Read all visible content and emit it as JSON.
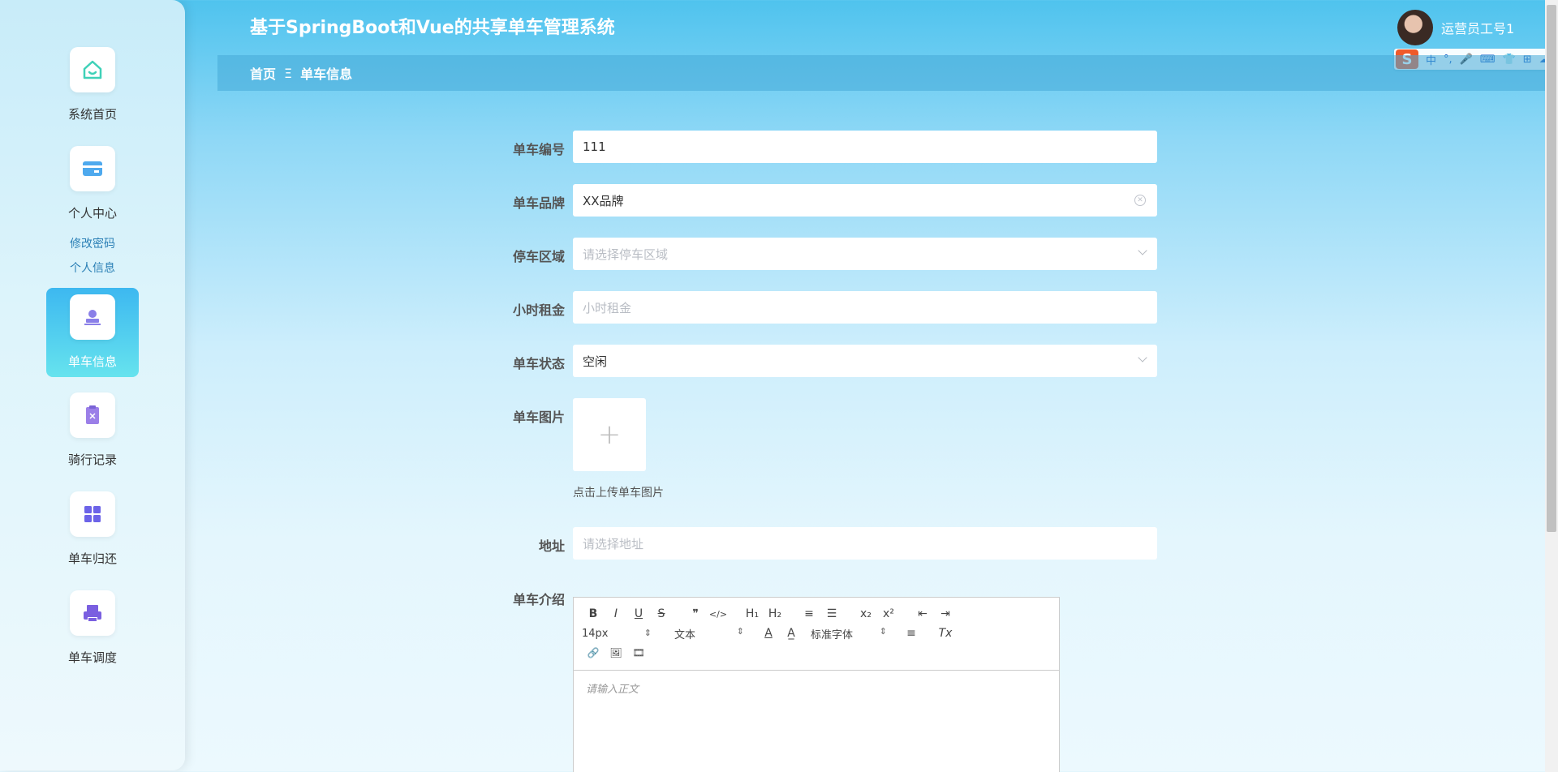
{
  "app": {
    "title": "基于SpringBoot和Vue的共享单车管理系统"
  },
  "breadcrumb": {
    "home": "首页",
    "separator": "Ξ",
    "current": "单车信息"
  },
  "user": {
    "name": "运营员工号1"
  },
  "ime": {
    "icons": [
      "中",
      "°,",
      "🎤",
      "⌨",
      "👕",
      "⊞",
      "☁"
    ]
  },
  "sidebar": {
    "items": [
      {
        "label": "系统首页",
        "icon": "home-icon",
        "color": "#3fd1b8"
      },
      {
        "label": "个人中心",
        "icon": "card-icon",
        "color": "#4ea9ee"
      },
      {
        "label": "单车信息",
        "icon": "stamp-icon",
        "color": "#8a7fe8",
        "active": true
      },
      {
        "label": "骑行记录",
        "icon": "clipboard-icon",
        "color": "#9b7fe8"
      },
      {
        "label": "单车归还",
        "icon": "grid-icon",
        "color": "#6c63e8"
      },
      {
        "label": "单车调度",
        "icon": "printer-icon",
        "color": "#7a5fe0"
      }
    ],
    "sub_items": [
      "修改密码",
      "个人信息"
    ]
  },
  "form": {
    "bike_number": {
      "label": "单车编号",
      "value": "111"
    },
    "bike_brand": {
      "label": "单车品牌",
      "value": "XX品牌"
    },
    "parking_area": {
      "label": "停车区域",
      "placeholder": "请选择停车区域"
    },
    "hourly_rent": {
      "label": "小时租金",
      "placeholder": "小时租金"
    },
    "bike_status": {
      "label": "单车状态",
      "value": "空闲"
    },
    "bike_image": {
      "label": "单车图片",
      "upload_icon": "+",
      "tip": "点击上传单车图片"
    },
    "address": {
      "label": "地址",
      "placeholder": "请选择地址"
    },
    "bike_intro": {
      "label": "单车介绍"
    }
  },
  "editor": {
    "row1": [
      "B",
      "I",
      "U",
      "S",
      "❞",
      "</>",
      "H₁",
      "H₂",
      "≡",
      "☰",
      "x₂",
      "x²",
      "⇤",
      "⇥"
    ],
    "font_size": "14px",
    "text_style": "文本",
    "font_family": "标准字体",
    "row2_icons": [
      "A",
      "A̲",
      "≡",
      "Tx"
    ],
    "row3": [
      "🔗",
      "🖼",
      "🎞"
    ],
    "placeholder": "请输入正文"
  },
  "colors": {
    "accent": "#3db8f0",
    "active_gradient_end": "#66e3ee",
    "header_bg": "#4fc3ee"
  }
}
